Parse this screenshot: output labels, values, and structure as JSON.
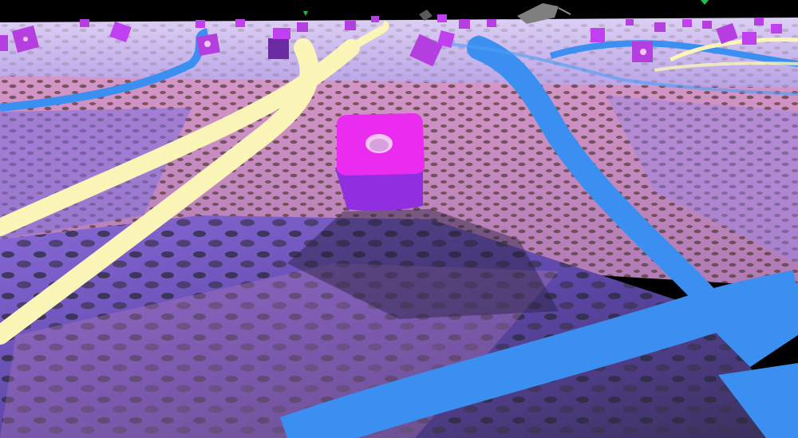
{
  "scene": {
    "kind": "3d-game-viewport",
    "hud_text": [],
    "colors": {
      "sky": "#000000",
      "terrain_light": "#c9a7e6",
      "terrain_pink": "#d596c8",
      "terrain_purple": "#7a5fd6",
      "terrain_dark": "#3a2f5a",
      "terrain_brown": "#6b4a3e",
      "road_blue": "#3b8ff0",
      "road_yellow": "#fbf6b8",
      "cube_top": "#ea2cf0",
      "cube_side": "#8f2fe0",
      "cube_hole": "#f3c6f5",
      "distant_cube": "#b43ee0",
      "green_marker": "#22c04a",
      "grey_debris": "#7f7f7f"
    },
    "objects": {
      "foreground_cube": {
        "icon": "pink-cube-with-hole"
      },
      "distant_cubes": {
        "icon": "small-pink-cubes"
      },
      "yellow_paths": {
        "icon": "yellow-stripe"
      },
      "blue_paths": {
        "icon": "blue-stripe"
      },
      "green_markers": {
        "icon": "green-marker"
      },
      "debris": {
        "icon": "grey-wreckage"
      }
    }
  }
}
